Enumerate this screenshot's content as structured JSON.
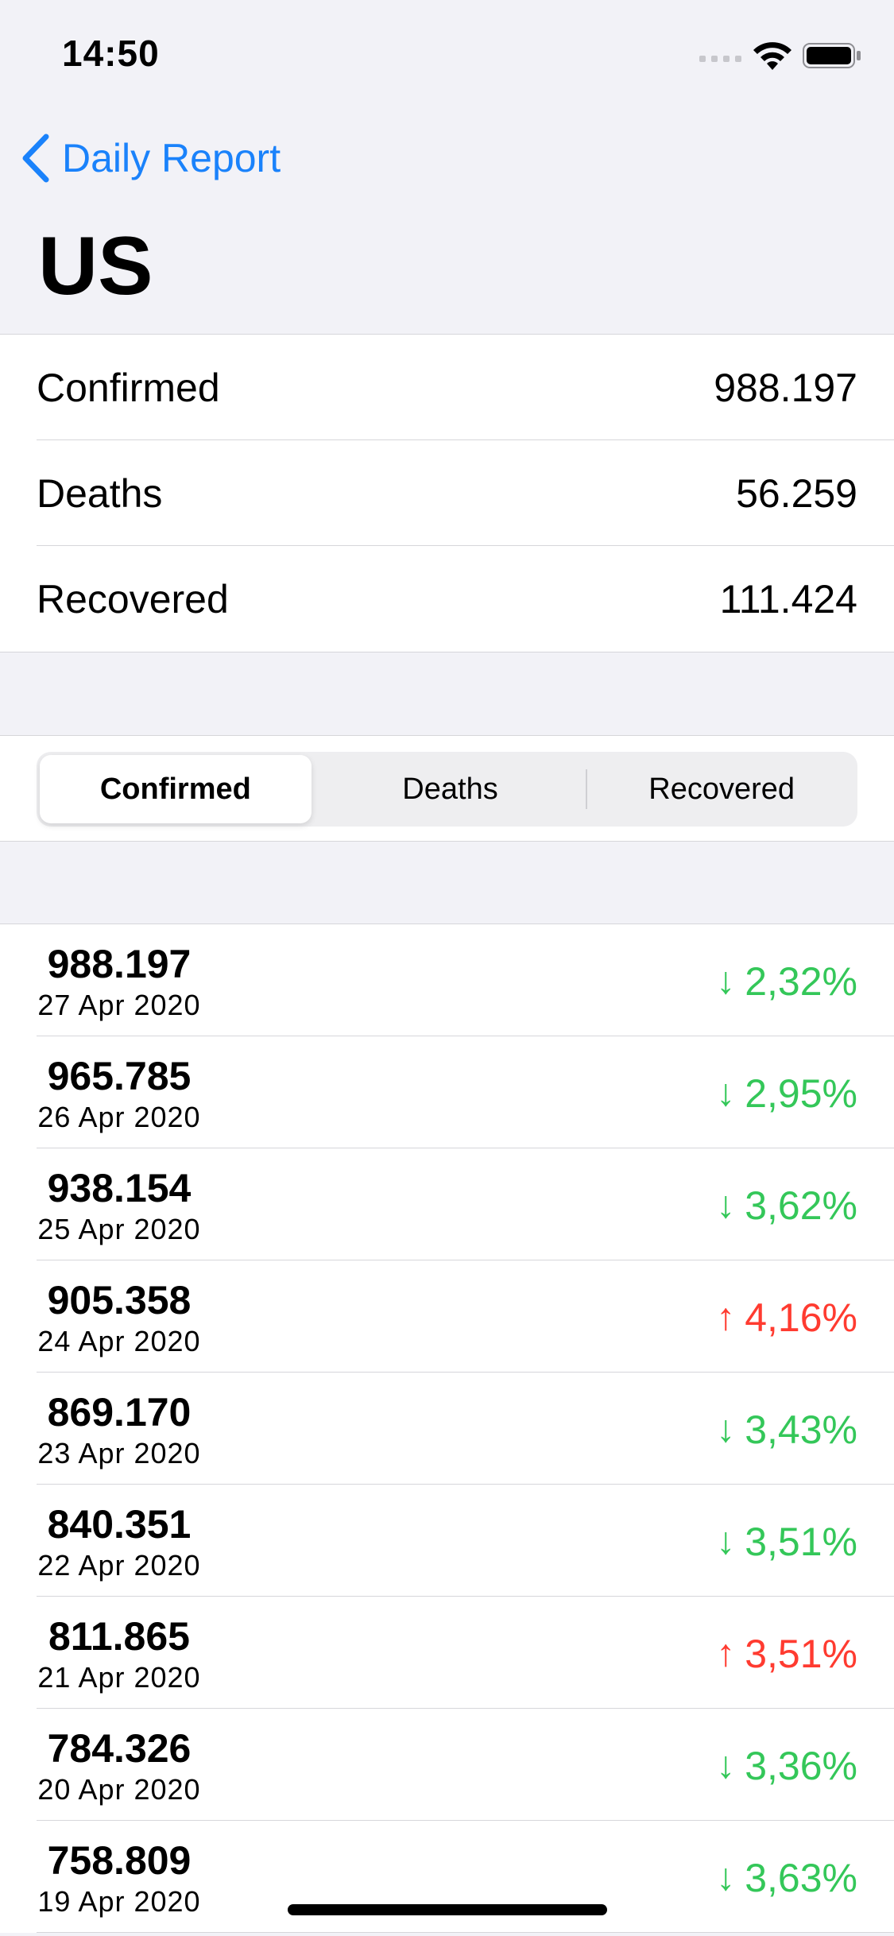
{
  "status_bar": {
    "time": "14:50"
  },
  "nav": {
    "back_label": "Daily Report",
    "title": "US"
  },
  "colors": {
    "accent": "#1a82fb",
    "decrease": "#34c759",
    "increase": "#ff3b30"
  },
  "summary": [
    {
      "label": "Confirmed",
      "value": "988.197"
    },
    {
      "label": "Deaths",
      "value": "56.259"
    },
    {
      "label": "Recovered",
      "value": "111.424"
    }
  ],
  "segments": {
    "options": [
      "Confirmed",
      "Deaths",
      "Recovered"
    ],
    "selected": "Confirmed"
  },
  "history": [
    {
      "value": "988.197",
      "date": "27 Apr 2020",
      "change": "2,32%",
      "direction": "down"
    },
    {
      "value": "965.785",
      "date": "26 Apr 2020",
      "change": "2,95%",
      "direction": "down"
    },
    {
      "value": "938.154",
      "date": "25 Apr 2020",
      "change": "3,62%",
      "direction": "down"
    },
    {
      "value": "905.358",
      "date": "24 Apr 2020",
      "change": "4,16%",
      "direction": "up"
    },
    {
      "value": "869.170",
      "date": "23 Apr 2020",
      "change": "3,43%",
      "direction": "down"
    },
    {
      "value": "840.351",
      "date": "22 Apr 2020",
      "change": "3,51%",
      "direction": "down"
    },
    {
      "value": "811.865",
      "date": "21 Apr 2020",
      "change": "3,51%",
      "direction": "up"
    },
    {
      "value": "784.326",
      "date": "20 Apr 2020",
      "change": "3,36%",
      "direction": "down"
    },
    {
      "value": "758.809",
      "date": "19 Apr 2020",
      "change": "3,63%",
      "direction": "down"
    }
  ]
}
